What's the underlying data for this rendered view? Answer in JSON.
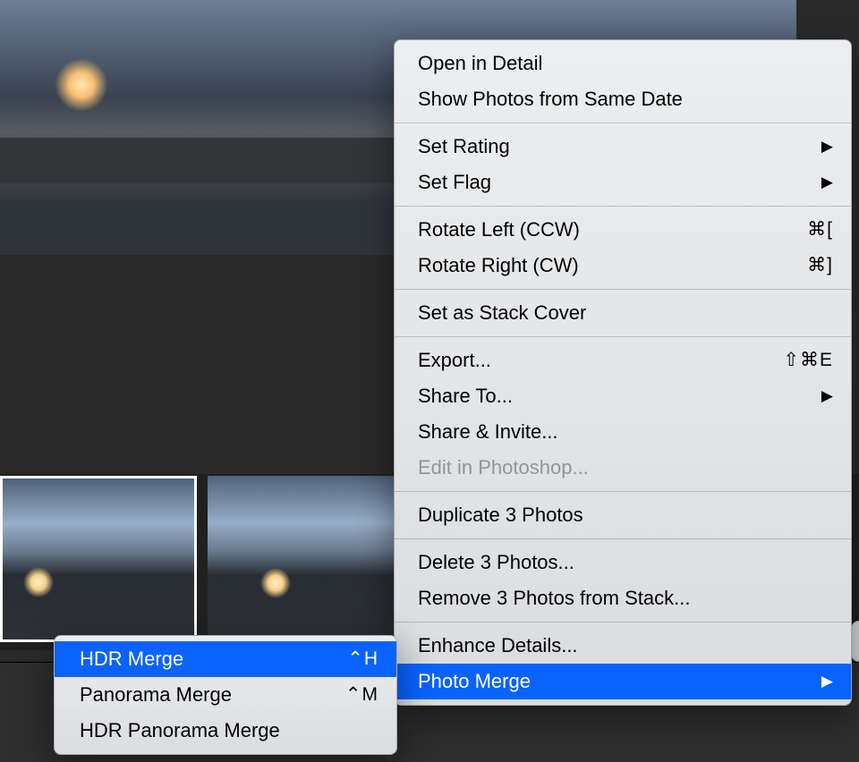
{
  "menu": {
    "open_detail": "Open in Detail",
    "same_date": "Show Photos from Same Date",
    "set_rating": "Set Rating",
    "set_flag": "Set Flag",
    "rotate_left": "Rotate Left (CCW)",
    "rotate_left_sc": "⌘[",
    "rotate_right": "Rotate Right (CW)",
    "rotate_right_sc": "⌘]",
    "stack_cover": "Set as Stack Cover",
    "export": "Export...",
    "export_sc": "⇧⌘E",
    "share_to": "Share To...",
    "share_invite": "Share & Invite...",
    "edit_ps": "Edit in Photoshop...",
    "duplicate": "Duplicate 3 Photos",
    "delete": "Delete 3 Photos...",
    "remove_stack": "Remove 3 Photos from Stack...",
    "enhance": "Enhance Details...",
    "photo_merge": "Photo Merge"
  },
  "submenu": {
    "hdr": "HDR Merge",
    "hdr_sc": "⌃H",
    "pano": "Panorama Merge",
    "pano_sc": "⌃M",
    "hdr_pano": "HDR Panorama Merge"
  }
}
